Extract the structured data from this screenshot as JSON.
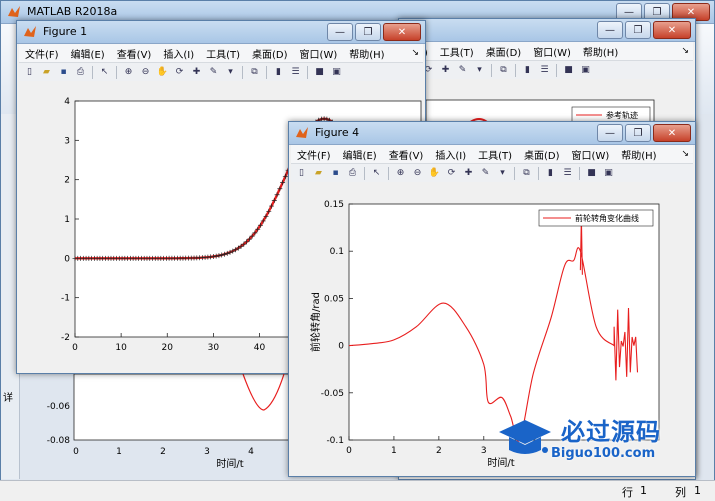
{
  "matlab": {
    "title": "MATLAB R2018a",
    "status_row_label": "行",
    "status_row": "1",
    "status_col_label": "列",
    "status_col": "1",
    "edge_label": "详"
  },
  "fig1": {
    "title": "Figure 1",
    "menu": [
      "文件(F)",
      "编辑(E)",
      "查看(V)",
      "插入(I)",
      "工具(T)",
      "桌面(D)",
      "窗口(W)",
      "帮助(H)"
    ],
    "ticks_x": [
      "0",
      "10",
      "20",
      "30",
      "40",
      "50",
      "60",
      "7"
    ],
    "ticks_y": [
      "4",
      "3",
      "2",
      "1",
      "0",
      "-1",
      "-2"
    ]
  },
  "fig_back": {
    "menu": [
      "入(I)",
      "工具(T)",
      "桌面(D)",
      "窗口(W)",
      "帮助(H)"
    ],
    "legend": "参考轨迹",
    "ticks_y": [
      "-0.06",
      "-0.08"
    ],
    "ticks_x": [
      "0",
      "1",
      "2",
      "3",
      "4"
    ],
    "xlabel": "时间/t"
  },
  "fig4": {
    "title": "Figure 4",
    "menu": [
      "文件(F)",
      "编辑(E)",
      "查看(V)",
      "插入(I)",
      "工具(T)",
      "桌面(D)",
      "窗口(W)",
      "帮助(H)"
    ],
    "legend": "前轮转角变化曲线",
    "ylabel": "前轮转角/rad",
    "xlabel": "时间/t",
    "ticks_y": [
      "0.15",
      "0.1",
      "0.05",
      "0",
      "-0.05",
      "-0.1"
    ],
    "ticks_x": [
      "0",
      "1",
      "2",
      "3"
    ]
  },
  "watermark": {
    "text": "必过源码",
    "url": "Biguo100.com"
  },
  "colors": {
    "accent": "#e81e1e",
    "axis": "#262626"
  },
  "chart_data": [
    {
      "type": "line",
      "series": [
        {
          "values": [
            [
              0,
              0
            ],
            [
              10,
              0
            ],
            [
              20,
              0.02
            ],
            [
              30,
              0.4
            ],
            [
              40,
              1.7
            ],
            [
              50,
              3.3
            ],
            [
              54,
              3.55
            ],
            [
              60,
              2.6
            ],
            [
              68,
              0.6
            ],
            [
              72,
              -0.2
            ]
          ]
        }
      ],
      "xlim": [
        0,
        72
      ],
      "ylim": [
        -2,
        4
      ],
      "xticks": [
        0,
        10,
        20,
        30,
        40,
        50,
        60,
        70
      ],
      "yticks": [
        -2,
        -1,
        0,
        1,
        2,
        3,
        4
      ]
    },
    {
      "type": "line",
      "series": [
        {
          "name": "前轮转角变化曲线",
          "values": [
            [
              0,
              0
            ],
            [
              0.5,
              0.002
            ],
            [
              1,
              0.006
            ],
            [
              1.5,
              0.02
            ],
            [
              2.1,
              0.045
            ],
            [
              2.6,
              0.02
            ],
            [
              3,
              -0.02
            ],
            [
              3.1,
              -0.06
            ],
            [
              3.4,
              -0.055
            ],
            [
              3.6,
              -0.075
            ],
            [
              3.8,
              -0.1
            ],
            [
              4.1,
              -0.03
            ],
            [
              4.5,
              0.03
            ],
            [
              4.8,
              0.085
            ],
            [
              5.0,
              0.09
            ],
            [
              5.15,
              0.1
            ],
            [
              5.5,
              0.02
            ],
            [
              5.9,
              0
            ]
          ]
        }
      ],
      "xlabel": "时间/t",
      "ylabel": "前轮转角/rad",
      "ylim": [
        -0.1,
        0.15
      ],
      "yticks": [
        -0.1,
        -0.05,
        0,
        0.05,
        0.1,
        0.15
      ],
      "xticks": [
        0,
        1,
        2,
        3
      ]
    }
  ]
}
